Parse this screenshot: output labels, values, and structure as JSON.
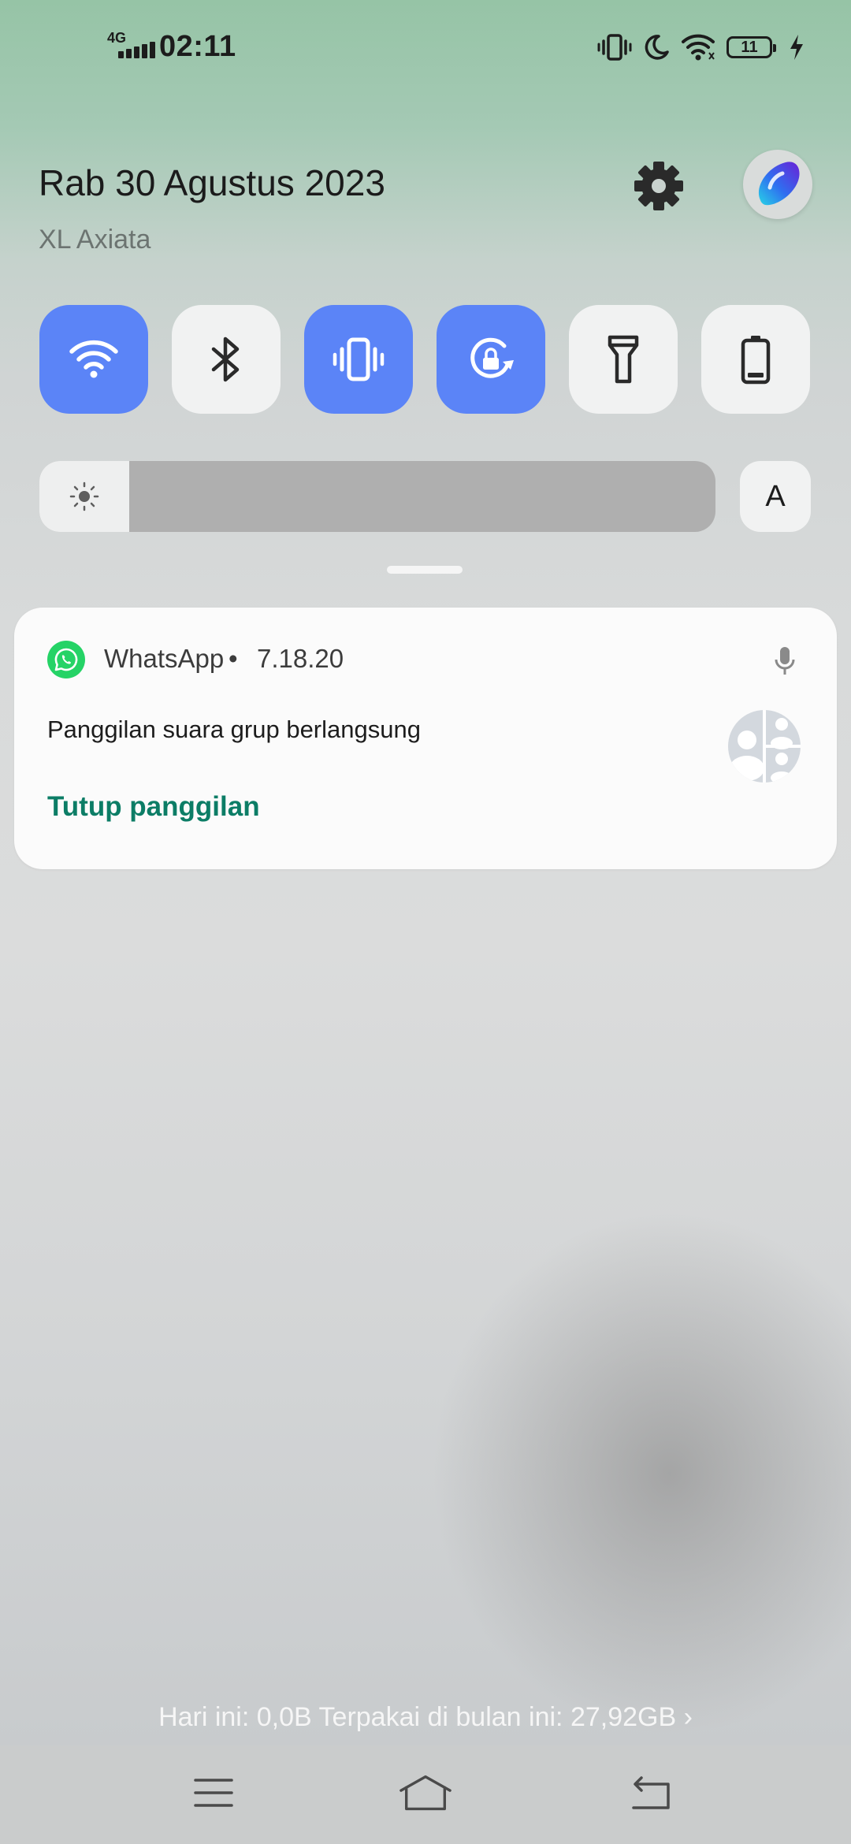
{
  "status_bar": {
    "network_type": "4G",
    "time": "02:11",
    "battery_level": "11",
    "icons": [
      "signal-icon",
      "vibrate-icon",
      "moon-icon",
      "wifi-icon",
      "battery-icon",
      "charging-icon"
    ]
  },
  "header": {
    "date": "Rab 30 Agustus 2023",
    "carrier": "XL Axiata",
    "settings_icon": "gear-icon"
  },
  "quick_settings": {
    "tiles": [
      {
        "icon": "wifi-icon",
        "active": true
      },
      {
        "icon": "bluetooth-icon",
        "active": false
      },
      {
        "icon": "vibrate-icon",
        "active": true
      },
      {
        "icon": "rotation-lock-icon",
        "active": true
      },
      {
        "icon": "flashlight-icon",
        "active": false
      },
      {
        "icon": "battery-saver-icon",
        "active": false
      }
    ],
    "brightness_level": 0.12,
    "auto_brightness_label": "A"
  },
  "notification": {
    "app_name": "WhatsApp",
    "separator": "•",
    "time": "7.18.20",
    "text": "Panggilan suara grup berlangsung",
    "action_label": "Tutup panggilan"
  },
  "footer": {
    "data_usage": "Hari ini: 0,0B Terpakai di bulan ini: 27,92GB ›"
  },
  "colors": {
    "tile_active": "#5b84f7",
    "tile_inactive": "#f1f2f2",
    "whatsapp_green": "#25d366",
    "action_green": "#0c7d66"
  }
}
